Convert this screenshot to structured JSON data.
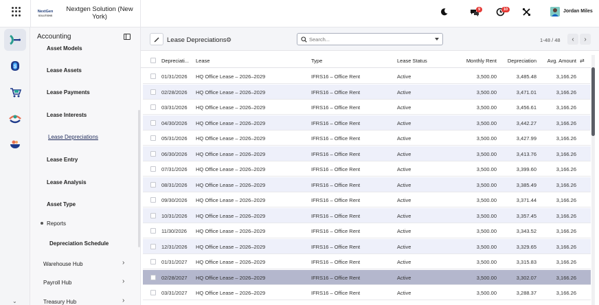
{
  "topbar": {
    "company": "Nextgen Solution (New York)",
    "logo_text": "NextGen SOLUTIONS",
    "chat_badge": "9",
    "activity_badge": "10",
    "user": "Jordan Miles",
    "icons": [
      "apps-grid-icon",
      "moon-icon",
      "chat-icon",
      "activity-clock-icon",
      "tools-icon"
    ]
  },
  "rail": {
    "icons": [
      "accounting-app-icon",
      "billing-app-icon",
      "cart-app-icon",
      "visibility-app-icon",
      "bowl-app-icon"
    ]
  },
  "sidebar": {
    "title": "Accounting",
    "items": [
      {
        "label": "Asset Models"
      },
      {
        "label": "Lease Assets"
      },
      {
        "label": "Lease Payments"
      },
      {
        "label": "Lease Interests"
      },
      {
        "label": "Lease Depreciations"
      },
      {
        "label": "Lease Entry"
      },
      {
        "label": "Lease Analysis"
      },
      {
        "label": "Asset Type"
      }
    ],
    "reports_label": "Reports",
    "report_item": "Depreciation Schedule",
    "hubs": [
      "Warehouse Hub",
      "Payroll Hub",
      "Treasury Hub"
    ]
  },
  "main": {
    "title": "Lease Depreciations",
    "search_placeholder": "Search...",
    "pager": "1-48 / 48",
    "columns": [
      "Depreciati...",
      "Lease",
      "Type",
      "Lease Status",
      "Monthly Rent",
      "Depreciation",
      "Avg. Amount"
    ],
    "rows": [
      {
        "date": "01/31/2026",
        "lease": "HQ Office Lease – 2026–2029",
        "type": "IFRS16 – Office Rent",
        "status": "Active",
        "rent": "3,500.00",
        "dep": "3,485.48",
        "avg": "3,166.26"
      },
      {
        "date": "02/28/2026",
        "lease": "HQ Office Lease – 2026–2029",
        "type": "IFRS16 – Office Rent",
        "status": "Active",
        "rent": "3,500.00",
        "dep": "3,471.01",
        "avg": "3,166.26"
      },
      {
        "date": "03/31/2026",
        "lease": "HQ Office Lease – 2026–2029",
        "type": "IFRS16 – Office Rent",
        "status": "Active",
        "rent": "3,500.00",
        "dep": "3,456.61",
        "avg": "3,166.26"
      },
      {
        "date": "04/30/2026",
        "lease": "HQ Office Lease – 2026–2029",
        "type": "IFRS16 – Office Rent",
        "status": "Active",
        "rent": "3,500.00",
        "dep": "3,442.27",
        "avg": "3,166.26"
      },
      {
        "date": "05/31/2026",
        "lease": "HQ Office Lease – 2026–2029",
        "type": "IFRS16 – Office Rent",
        "status": "Active",
        "rent": "3,500.00",
        "dep": "3,427.99",
        "avg": "3,166.26"
      },
      {
        "date": "06/30/2026",
        "lease": "HQ Office Lease – 2026–2029",
        "type": "IFRS16 – Office Rent",
        "status": "Active",
        "rent": "3,500.00",
        "dep": "3,413.76",
        "avg": "3,166.26"
      },
      {
        "date": "07/31/2026",
        "lease": "HQ Office Lease – 2026–2029",
        "type": "IFRS16 – Office Rent",
        "status": "Active",
        "rent": "3,500.00",
        "dep": "3,399.60",
        "avg": "3,166.26"
      },
      {
        "date": "08/31/2026",
        "lease": "HQ Office Lease – 2026–2029",
        "type": "IFRS16 – Office Rent",
        "status": "Active",
        "rent": "3,500.00",
        "dep": "3,385.49",
        "avg": "3,166.26"
      },
      {
        "date": "09/30/2026",
        "lease": "HQ Office Lease – 2026–2029",
        "type": "IFRS16 – Office Rent",
        "status": "Active",
        "rent": "3,500.00",
        "dep": "3,371.44",
        "avg": "3,166.26"
      },
      {
        "date": "10/31/2026",
        "lease": "HQ Office Lease – 2026–2029",
        "type": "IFRS16 – Office Rent",
        "status": "Active",
        "rent": "3,500.00",
        "dep": "3,357.45",
        "avg": "3,166.26"
      },
      {
        "date": "11/30/2026",
        "lease": "HQ Office Lease – 2026–2029",
        "type": "IFRS16 – Office Rent",
        "status": "Active",
        "rent": "3,500.00",
        "dep": "3,343.52",
        "avg": "3,166.26"
      },
      {
        "date": "12/31/2026",
        "lease": "HQ Office Lease – 2026–2029",
        "type": "IFRS16 – Office Rent",
        "status": "Active",
        "rent": "3,500.00",
        "dep": "3,329.65",
        "avg": "3,166.26"
      },
      {
        "date": "01/31/2027",
        "lease": "HQ Office Lease – 2026–2029",
        "type": "IFRS16 – Office Rent",
        "status": "Active",
        "rent": "3,500.00",
        "dep": "3,315.83",
        "avg": "3,166.26"
      },
      {
        "date": "02/28/2027",
        "lease": "HQ Office Lease – 2026–2029",
        "type": "IFRS16 – Office Rent",
        "status": "Active",
        "rent": "3,500.00",
        "dep": "3,302.07",
        "avg": "3,166.26"
      },
      {
        "date": "03/31/2027",
        "lease": "HQ Office Lease – 2026–2029",
        "type": "IFRS16 – Office Rent",
        "status": "Active",
        "rent": "3,500.00",
        "dep": "3,288.37",
        "avg": "3,166.26"
      }
    ]
  },
  "colors": {
    "row_alt": "#eef0fa",
    "row_selected": "#b4b7cd",
    "badge": "#e53935",
    "accent": "#1e2a5a"
  }
}
